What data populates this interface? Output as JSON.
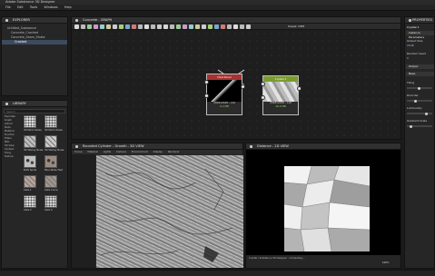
{
  "app": {
    "title": "Adobe Substance 3D Designer"
  },
  "menu": [
    "File",
    "Edit",
    "Tools",
    "Windows",
    "Help"
  ],
  "explorer": {
    "title": "EXPLORER",
    "items": [
      {
        "label": "Untitled_Substance"
      },
      {
        "label": "Concrete_Cracked"
      },
      {
        "label": "Concrete_Seam_Strata"
      },
      {
        "label": "Cracked"
      }
    ]
  },
  "library": {
    "title": "LIBRARY",
    "search_placeholder": "Search",
    "categories": [
      "Favorites",
      "Graph",
      "Atomic",
      "Node",
      "Material",
      "Function",
      "Filters",
      "MDL",
      "3D View",
      "Content",
      "Tiling",
      "Texture"
    ],
    "thumbs": [
      {
        "label": "3D Perlin Noise",
        "color": "#d9d9d9",
        "pattern": "dots"
      },
      {
        "label": "3D Perlin Noise",
        "color": "#cfcfcf",
        "pattern": "dots"
      },
      {
        "label": "3D Worley Noise",
        "color": "#bdbdbd",
        "pattern": "cells"
      },
      {
        "label": "3D Worley Noise",
        "color": "#c8c8c8",
        "pattern": "cells"
      },
      {
        "label": "BnW Spots",
        "color": "#bfbfbf",
        "pattern": "spots"
      },
      {
        "label": "Blue Noise Fast",
        "color": "#9c8b80",
        "pattern": "spots"
      },
      {
        "label": "Cells 1",
        "color": "#b7a39a",
        "pattern": "cells"
      },
      {
        "label": "Cells Curve",
        "color": "#a0958e",
        "pattern": "cells"
      },
      {
        "label": "Cells 2",
        "color": "#d8d8d8",
        "pattern": "dots"
      },
      {
        "label": "Cells 4",
        "color": "#cfcfcf",
        "pattern": "dots"
      }
    ]
  },
  "graph": {
    "tab": "Concrete - GRAPH",
    "zoom": "Preset: DPM",
    "node_a": {
      "title": "Directional",
      "info": "2048x2048 - L16",
      "size": "6.2 MB"
    },
    "node_b": {
      "title": "Crystal 1",
      "info": "2048x2048 - L16",
      "size": "16.4 MB"
    }
  },
  "view3d": {
    "tab": "Rounded Cylinder - Growth - 3D VIEW",
    "menu": [
      "Scene",
      "Material",
      "Lights",
      "Camera",
      "Environment",
      "Display",
      "Renderer"
    ]
  },
  "view2d": {
    "tab": "Distance - 2D VIEW",
    "status": "Crystal / Substance 3D Designer - Computing...",
    "zoom": "100%"
  },
  "properties": {
    "title": "PROPERTIES",
    "node": "Crystal 1",
    "sections": [
      "Instance Parameters",
      "Output",
      "Base"
    ],
    "fields": [
      {
        "label": "Output Size",
        "value": "2048"
      },
      {
        "label": "Random Seed",
        "value": "0"
      },
      {
        "label": "Tiling",
        "value": "3"
      },
      {
        "label": "Disorder",
        "value": "0.5"
      },
      {
        "label": "Luminosity",
        "value": "0.85"
      },
      {
        "label": "Gradient Scale",
        "value": "0.1"
      }
    ]
  },
  "colors": {
    "accent": "#4a78b8",
    "node_a_head": "#a63333",
    "node_b_head": "#7a9b2e",
    "size_ok": "#8fd36a"
  }
}
